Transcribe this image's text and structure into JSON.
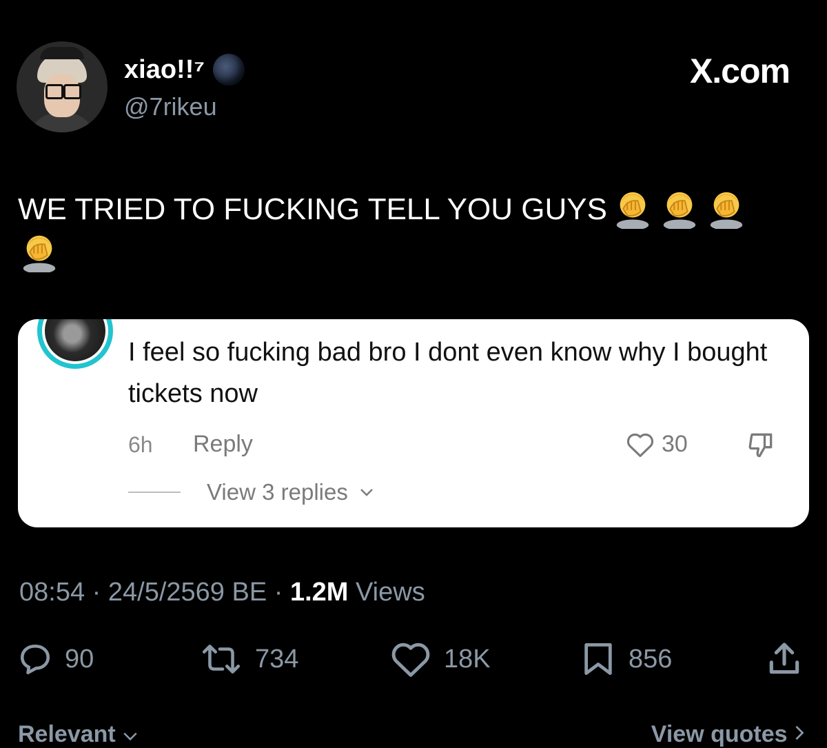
{
  "author": {
    "display_name": "xiao!!⁷",
    "handle": "@7rikeu"
  },
  "brand": "X.com",
  "tweet": {
    "text": "WE TRIED TO FUCKING TELL YOU GUYS",
    "emoji_count": 4
  },
  "embedded_comment": {
    "text": "I feel so fucking bad bro I dont even know why I bought tickets now",
    "time": "6h",
    "reply_label": "Reply",
    "likes": "30",
    "view_replies": "View 3 replies"
  },
  "timestamp": {
    "time": "08:54",
    "date": "24/5/2569 BE",
    "views_count": "1.2M",
    "views_label": "Views"
  },
  "actions": {
    "replies": "90",
    "reposts": "734",
    "likes": "18K",
    "bookmarks": "856"
  },
  "footer": {
    "sort_label": "Relevant",
    "quotes_label": "View quotes"
  },
  "colors": {
    "background": "#000000",
    "secondary_text": "#8b98a5",
    "card_ring": "#21c4cf"
  }
}
